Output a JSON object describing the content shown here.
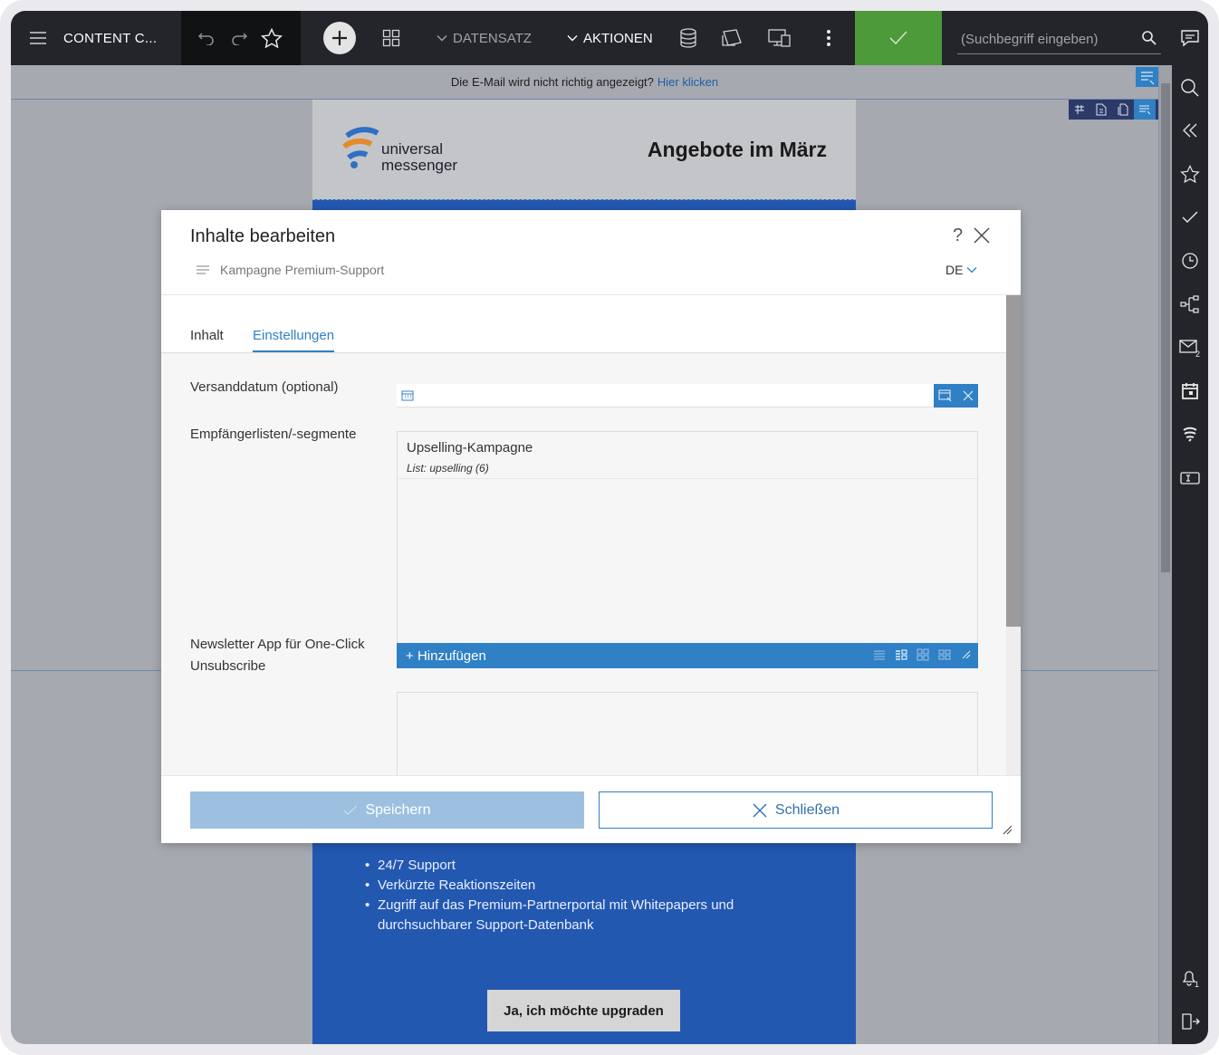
{
  "topbar": {
    "title": "CONTENT C...",
    "menu_datensatz": "DATENSATZ",
    "menu_aktionen": "AKTIONEN",
    "search_placeholder": "(Suchbegriff eingeben)",
    "confirm_color": "#4c9a3a"
  },
  "email": {
    "notice_text": "Die E-Mail wird nicht richtig angezeigt?",
    "notice_link": "Hier klicken",
    "logo_line1": "universal",
    "logo_line2": "messenger",
    "headline": "Angebote im März",
    "bullets": [
      "24/7 Support",
      "Verkürzte Reaktionszeiten",
      "Zugriff auf das Premium-Partnerportal mit Whitepapers und durchsuchbarer Support-Datenbank"
    ],
    "cta": "Ja, ich möchte upgraden",
    "background_color": "#2358b1"
  },
  "dialog": {
    "title": "Inhalte bearbeiten",
    "help": "?",
    "subtitle": "Kampagne Premium-Support",
    "language": "DE",
    "tabs": [
      {
        "label": "Inhalt",
        "active": false
      },
      {
        "label": "Einstellungen",
        "active": true
      }
    ],
    "fields": {
      "versanddatum_label": "Versanddatum (optional)",
      "versanddatum_value": "",
      "empfaenger_label": "Empfängerlisten/-segmente",
      "empfaenger_items": [
        {
          "title": "Upselling-Kampagne",
          "subtitle": "List: upselling (6)"
        }
      ],
      "add_label": "Hinzufügen",
      "newsletter_label_line1": "Newsletter App für One-Click",
      "newsletter_label_line2": "Unsubscribe"
    },
    "save_label": "Speichern",
    "close_label": "Schließen",
    "accent_color": "#2f80c5"
  }
}
